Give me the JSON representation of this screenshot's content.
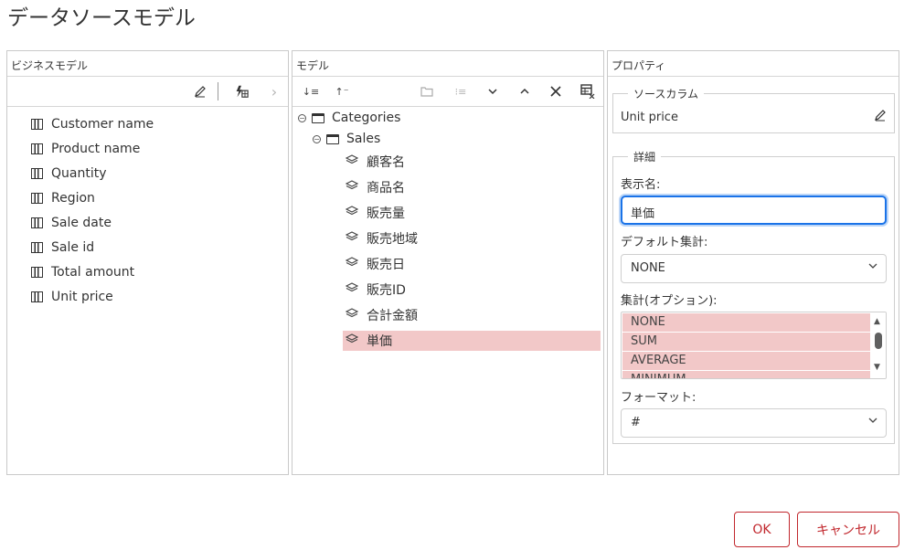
{
  "page": {
    "title": "データソースモデル"
  },
  "business_panel": {
    "header": "ビジネスモデル",
    "toolbar": {
      "edit_icon": "pencil-icon",
      "formula_icon": "formula-icon",
      "next_icon": "chevron-right-icon"
    },
    "items": [
      {
        "label": "Customer name",
        "icon": "column-icon"
      },
      {
        "label": "Product name",
        "icon": "column-icon"
      },
      {
        "label": "Quantity",
        "icon": "column-icon"
      },
      {
        "label": "Region",
        "icon": "column-icon"
      },
      {
        "label": "Sale date",
        "icon": "column-icon"
      },
      {
        "label": "Sale id",
        "icon": "column-icon"
      },
      {
        "label": "Total amount",
        "icon": "column-icon"
      },
      {
        "label": "Unit price",
        "icon": "column-icon"
      }
    ]
  },
  "model_panel": {
    "header": "モデル",
    "toolbar": {
      "icons": [
        "sort-down-icon",
        "sort-up-icon",
        "folder-icon",
        "list-icon",
        "chevron-down-icon",
        "chevron-up-icon",
        "close-icon",
        "table-delete-icon"
      ]
    },
    "tree": {
      "root": {
        "label": "Categories",
        "toggle": "⊖"
      },
      "child": {
        "label": "Sales",
        "toggle": "⊖"
      },
      "leaves": [
        "顧客名",
        "商品名",
        "販売量",
        "販売地域",
        "販売日",
        "販売ID",
        "合計金額",
        "単価"
      ],
      "selected_index": 7
    }
  },
  "properties_panel": {
    "header": "プロパティ",
    "source_column": {
      "legend": "ソースカラム",
      "value": "Unit price"
    },
    "details": {
      "legend": "詳細",
      "display_name_label": "表示名:",
      "display_name_value": "単価",
      "default_agg_label": "デフォルト集計:",
      "default_agg_value": "NONE",
      "agg_options_label": "集計(オプション):",
      "agg_options": [
        "NONE",
        "SUM",
        "AVERAGE",
        "MINIMUM"
      ],
      "format_label": "フォーマット:",
      "format_value": "#"
    }
  },
  "buttons": {
    "ok": "OK",
    "cancel": "キャンセル"
  },
  "colors": {
    "accent": "#c1272d",
    "selection": "#f2c8c8",
    "focus": "#1a73e8"
  }
}
